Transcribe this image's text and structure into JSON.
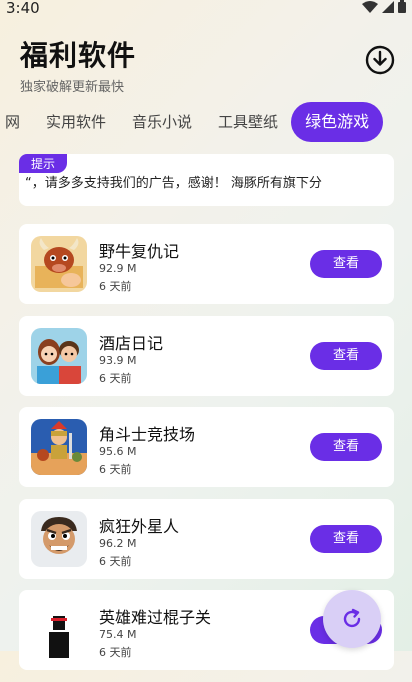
{
  "status_bar": {
    "time": "3:40"
  },
  "header": {
    "title": "福利软件",
    "subtitle": "独家破解更新最快"
  },
  "tabs": [
    {
      "label": "网"
    },
    {
      "label": "实用软件"
    },
    {
      "label": "音乐小说"
    },
    {
      "label": "工具壁纸"
    },
    {
      "label": "绿色游戏",
      "active": true
    }
  ],
  "notice": {
    "badge": "提示",
    "text": "“，请多多支持我们的广告，感谢！      海豚所有旗下分"
  },
  "apps": [
    {
      "name": "野牛复仇记",
      "size": "92.9 M",
      "time": "6 天前",
      "button": "查看"
    },
    {
      "name": "酒店日记",
      "size": "93.9 M",
      "time": "6 天前",
      "button": "查看"
    },
    {
      "name": "角斗士竞技场",
      "size": "95.6 M",
      "time": "6 天前",
      "button": "查看"
    },
    {
      "name": "疯狂外星人",
      "size": "96.2 M",
      "time": "6 天前",
      "button": "查看"
    },
    {
      "name": "英雄难过棍子关",
      "size": "75.4 M",
      "time": "6 天前",
      "button": "查看"
    }
  ],
  "colors": {
    "accent": "#6a2ee6",
    "fab": "#d9cff6"
  }
}
